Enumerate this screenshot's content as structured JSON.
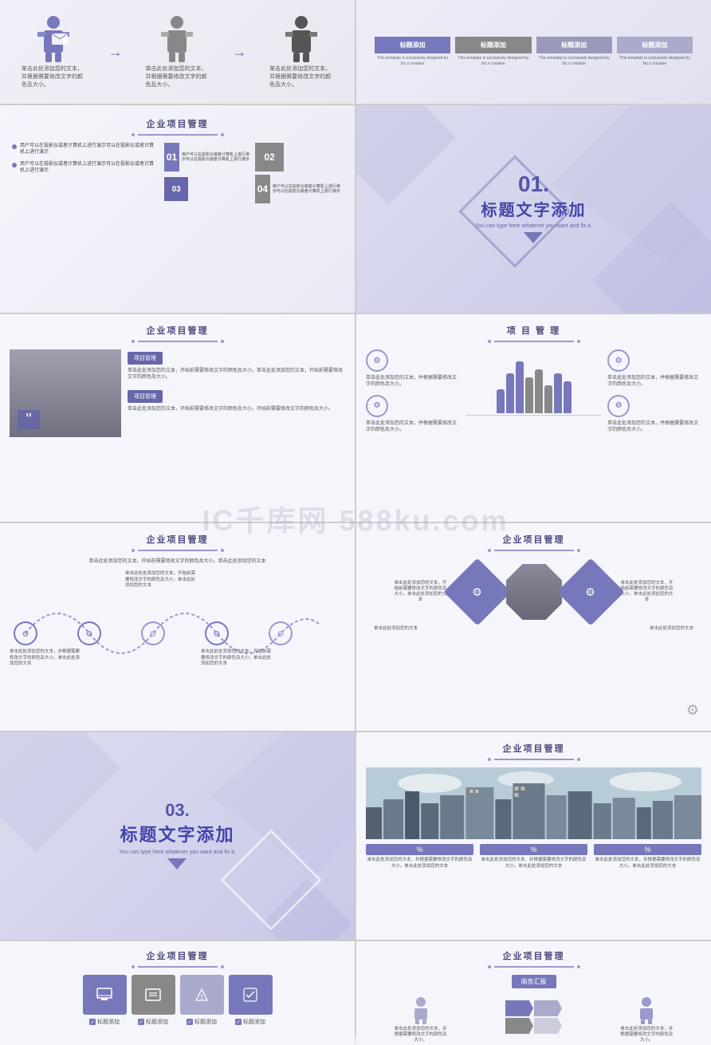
{
  "watermark": "IC千库网 588ku.com",
  "slides": [
    {
      "id": "r1-left",
      "type": "person-flow",
      "texts": [
        "单击此处添加您的文本，并根据需要修改文字的颜色及大小。",
        "单击此处添加您的文本，并根据需要修改文字的颜色及大小。",
        "单击此处添加您的文本，并根据需要修改文字的颜色及大小。"
      ]
    },
    {
      "id": "r1-right",
      "type": "title-cards",
      "cards": [
        "标题添加",
        "标题添加",
        "标题添加",
        "标题添加"
      ],
      "subtitle": "This template is exclusively designed by fsc.n creative"
    },
    {
      "id": "r2-left",
      "type": "project-numbered",
      "title": "企业项目管理",
      "bullets": [
        "用户可以在投影仪或者计算机上进行演示可以在投影仪或者计算机上进行演示",
        "用户可以在投影仪或者计算机上进行演示可以在投影仪或者计算机上进行演示"
      ],
      "items": [
        {
          "num": "01",
          "text": "用户可以在投影仪或者计算机上进行演示可以在投影仪或者计算机上进行演示"
        },
        {
          "num": "02",
          "text": ""
        },
        {
          "num": "03",
          "text": ""
        },
        {
          "num": "04",
          "text": "用户可以在投影仪或者计算机上进行演示可以在投影仪或者计算机上进行演示"
        }
      ]
    },
    {
      "id": "r2-right",
      "type": "title-slide",
      "number": "01.",
      "title": "标题文字添加",
      "subtitle": "You can type here whatever you want and fix it."
    },
    {
      "id": "r3-left",
      "type": "project-photo",
      "title": "企业项目管理",
      "tags": [
        "项目管理",
        "项目管理"
      ],
      "texts": [
        "单击此处添加您的文本，开始前需要修改文字的颜色及大小。单击此处添加您的文本，开始前需要修改文字的颜色及大小。",
        "单击此处添加您的文本，开始前需要修改文字的颜色及大小。开始前需要修改文字的颜色及大小。"
      ]
    },
    {
      "id": "r3-right",
      "type": "project-chart",
      "title": "项 目 管 理",
      "texts": [
        "单击此处添加您的文本，并根据需要修改文字的颜色及大小。",
        "单击此处添加您的文本，并根据需要修改文字的颜色及大小。",
        "单击此处添加您的文本，并根据需要修改文字的颜色及大小。",
        "单击此处添加您的文本，并根据需要修改文字的颜色及大小。"
      ],
      "bars": [
        30,
        50,
        70,
        45,
        60,
        35,
        55,
        40
      ]
    },
    {
      "id": "r4-left",
      "type": "timeline-wave",
      "title": "企业项目管理",
      "subtitle": "单击此处添加您的文本，开始前需要修改文字的颜色及大小。单击此处添加您的文本",
      "items": [
        "单击此处添加您的文本，并根据需要修改文字的颜色及大小。单击此处添加您的文本",
        "单击此处处添加您的文本，开始前需要修改文字的颜色及大小。单击此处添加您的文本",
        "单击此处处添加您的文本，开始前需要修改文字的颜色及大小。单击此处添加您的文本"
      ]
    },
    {
      "id": "r4-right",
      "type": "diamond-timeline",
      "title": "企业项目管理",
      "items": [
        "单击此处添加您的文本，开始前需要修改文字的颜色及大小。单击此处添加您的文本",
        "单击此处添加您的文本",
        "单击此处添加您的文本，开始前需要修改文字的颜色及大小。单击此处添加您的文本",
        "单击此处添加您的文本"
      ]
    },
    {
      "id": "r5-left",
      "type": "title-slide-2",
      "number": "03.",
      "title": "标题文字添加",
      "subtitle": "You can type here whatever you want and fix it."
    },
    {
      "id": "r5-right",
      "type": "city-project",
      "title": "企业项目管理",
      "items": [
        "单击此处添加您的文本，并根据需要修改文字的颜色及大小。单击此处添加您的文本",
        "单击此处添加您的文本，并根据需要修改文字的颜色及大小。单击此处添加您的文本",
        "单击此处添加您的文本，并根据需要修改文字的颜色及大小。单击此处添加您的文本"
      ]
    },
    {
      "id": "r6-left",
      "type": "icon-boxes",
      "title": "企业项目管理",
      "labels": [
        "标题添加",
        "标题添加"
      ]
    },
    {
      "id": "r6-right",
      "type": "arrow-flow",
      "title": "企业项目管理",
      "badge": "商务汇报",
      "texts": [
        "单击此处添加您的文本，并根据需要修改文字的颜色及大小。",
        "单击此处添加您的文本，并根据需要修改文字的颜色及大小。"
      ]
    }
  ]
}
